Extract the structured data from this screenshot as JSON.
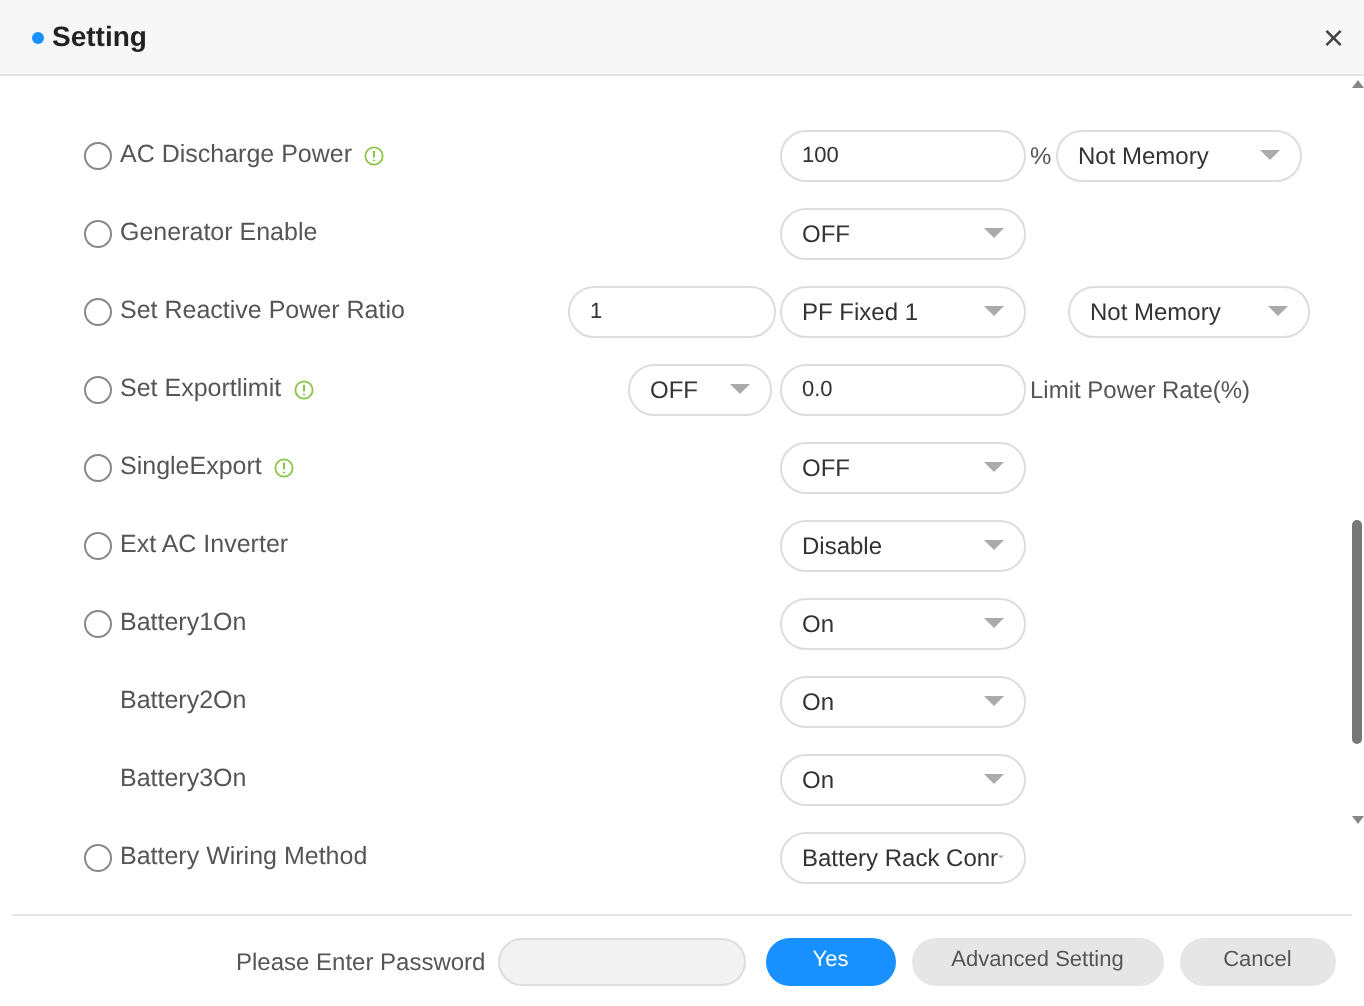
{
  "dialog": {
    "title": "Setting",
    "close": "×"
  },
  "rows": [
    {
      "kind": "option",
      "selected": false,
      "label": "AC Discharge Power",
      "info": true,
      "controls": [
        {
          "kind": "input",
          "value": "100",
          "unit": "%"
        },
        {
          "kind": "select",
          "value": "Not Memory"
        }
      ]
    },
    {
      "kind": "option",
      "selected": false,
      "label": "Generator Enable",
      "info": false,
      "controls": [
        {
          "kind": "select",
          "value": "OFF"
        }
      ]
    },
    {
      "kind": "option",
      "selected": false,
      "label": "Set Reactive Power Ratio",
      "info": false,
      "controls": [
        {
          "kind": "input",
          "value": "1"
        },
        {
          "kind": "select",
          "value": "PF Fixed 1"
        },
        {
          "kind": "select",
          "value": "Not Memory"
        }
      ]
    },
    {
      "kind": "option",
      "selected": false,
      "label": "Set Exportlimit",
      "info": true,
      "controls": [
        {
          "kind": "select",
          "value": "OFF"
        },
        {
          "kind": "input",
          "value": "0.0"
        },
        {
          "kind": "text",
          "value": "Limit Power Rate(%)"
        }
      ]
    },
    {
      "kind": "option",
      "selected": false,
      "label": "SingleExport",
      "info": true,
      "controls": [
        {
          "kind": "select",
          "value": "OFF"
        }
      ]
    },
    {
      "kind": "option",
      "selected": false,
      "label": "Ext AC Inverter",
      "info": false,
      "controls": [
        {
          "kind": "select",
          "value": "Disable"
        }
      ]
    },
    {
      "kind": "option",
      "selected": false,
      "label": "Battery1On",
      "info": false,
      "controls": [
        {
          "kind": "select",
          "value": "On"
        }
      ]
    },
    {
      "kind": "sub",
      "label": "Battery2On",
      "info": false,
      "controls": [
        {
          "kind": "select",
          "value": "On"
        }
      ]
    },
    {
      "kind": "sub",
      "label": "Battery3On",
      "info": false,
      "controls": [
        {
          "kind": "select",
          "value": "On"
        }
      ]
    },
    {
      "kind": "option",
      "selected": false,
      "label": "Battery Wiring Method",
      "info": false,
      "controls": [
        {
          "kind": "select",
          "value": "Battery Rack Conr"
        }
      ]
    }
  ],
  "footer": {
    "password_label": "Please Enter Password",
    "buttons": [
      {
        "kind": "primary",
        "label": "Yes"
      },
      {
        "kind": "secondary",
        "label": "Advanced Setting"
      },
      {
        "kind": "secondary",
        "label": "Cancel"
      }
    ]
  }
}
